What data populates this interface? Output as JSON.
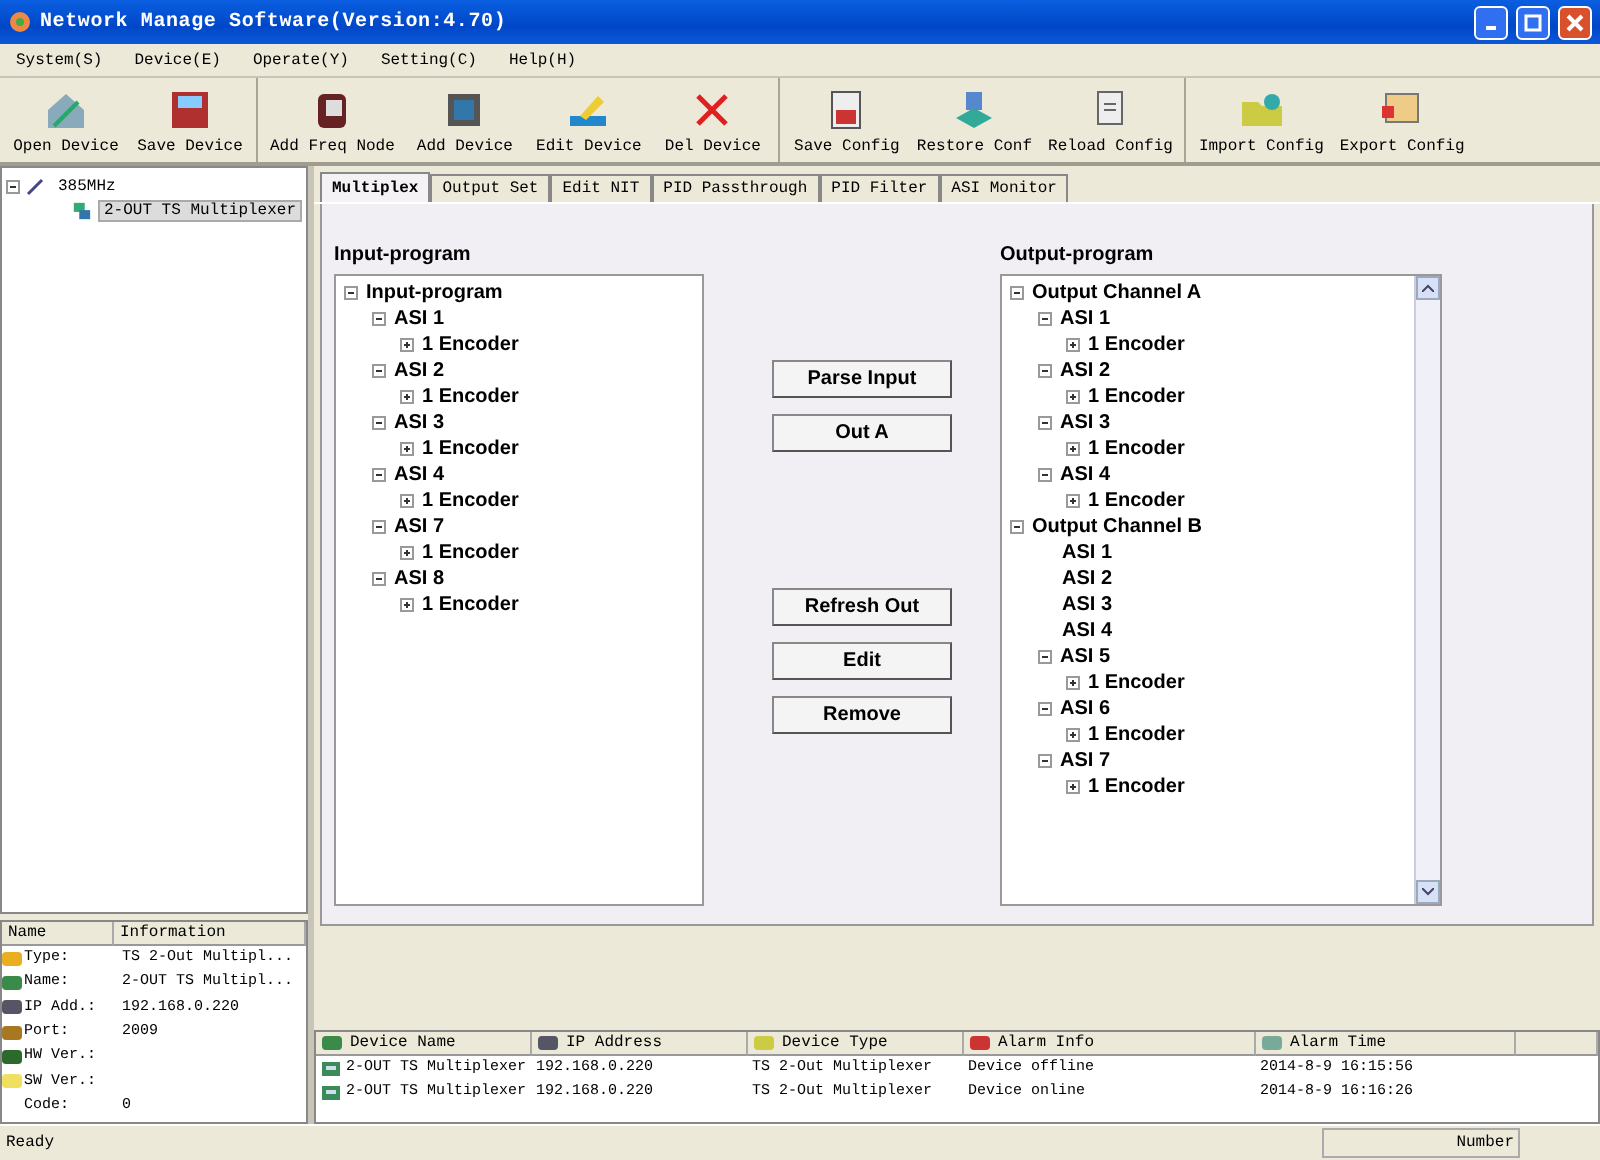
{
  "window": {
    "title": "Network Manage Software(Version:4.70)"
  },
  "menu": [
    "System(S)",
    "Device(E)",
    "Operate(Y)",
    "Setting(C)",
    "Help(H)"
  ],
  "toolbar": [
    [
      "Open Device",
      "Save Device"
    ],
    [
      "Add Freq Node",
      "Add Device",
      "Edit Device",
      "Del Device"
    ],
    [
      "Save Config",
      "Restore Conf",
      "Reload Config"
    ],
    [
      "Import Config",
      "Export Config"
    ]
  ],
  "device_tree": [
    {
      "label": "385MHz",
      "expanded": true,
      "selected": false,
      "children": [
        {
          "label": "2-OUT TS Multiplexer",
          "selected": true
        }
      ]
    }
  ],
  "info_panel": {
    "columns": [
      "Name",
      "Information"
    ],
    "rows": [
      {
        "name": "Type:",
        "value": "TS 2-Out Multipl..."
      },
      {
        "name": "Name:",
        "value": "2-OUT TS Multipl..."
      },
      {
        "name": "IP Add.:",
        "value": "192.168.0.220"
      },
      {
        "name": "Port:",
        "value": "2009"
      },
      {
        "name": "HW Ver.:",
        "value": ""
      },
      {
        "name": "SW Ver.:",
        "value": ""
      },
      {
        "name": "Code:",
        "value": "0"
      }
    ]
  },
  "tabs": [
    {
      "label": "Multiplex",
      "selected": true
    },
    {
      "label": "Output Set",
      "selected": false
    },
    {
      "label": "Edit NIT",
      "selected": false
    },
    {
      "label": "PID Passthrough",
      "selected": false
    },
    {
      "label": "PID Filter",
      "selected": false
    },
    {
      "label": "ASI Monitor",
      "selected": false
    }
  ],
  "input_program": {
    "label": "Input-program",
    "tree": [
      {
        "label": "Input-program",
        "expanded": true,
        "children": [
          {
            "label": "ASI 1",
            "expanded": true,
            "children": [
              {
                "label": "1 Encoder",
                "expanded": false
              }
            ]
          },
          {
            "label": "ASI 2",
            "expanded": true,
            "children": [
              {
                "label": "1 Encoder",
                "expanded": false
              }
            ]
          },
          {
            "label": "ASI 3",
            "expanded": true,
            "children": [
              {
                "label": "1 Encoder",
                "expanded": false
              }
            ]
          },
          {
            "label": "ASI 4",
            "expanded": true,
            "children": [
              {
                "label": "1 Encoder",
                "expanded": false
              }
            ]
          },
          {
            "label": "ASI 7",
            "expanded": true,
            "children": [
              {
                "label": "1 Encoder",
                "expanded": false
              }
            ]
          },
          {
            "label": "ASI 8",
            "expanded": true,
            "children": [
              {
                "label": "1 Encoder",
                "expanded": false
              }
            ]
          }
        ]
      }
    ]
  },
  "button_groups": [
    [
      "Parse Input",
      "Out A"
    ],
    [
      "Refresh Out",
      "Edit",
      "Remove"
    ]
  ],
  "output_program": {
    "label": "Output-program",
    "tree": [
      {
        "label": "Output Channel A",
        "expanded": true,
        "children": [
          {
            "label": "ASI 1",
            "expanded": true,
            "children": [
              {
                "label": "1 Encoder",
                "expanded": false
              }
            ]
          },
          {
            "label": "ASI 2",
            "expanded": true,
            "children": [
              {
                "label": "1 Encoder",
                "expanded": false
              }
            ]
          },
          {
            "label": "ASI 3",
            "expanded": true,
            "children": [
              {
                "label": "1 Encoder",
                "expanded": false
              }
            ]
          },
          {
            "label": "ASI 4",
            "expanded": true,
            "children": [
              {
                "label": "1 Encoder",
                "expanded": false
              }
            ]
          }
        ]
      },
      {
        "label": "Output Channel B",
        "expanded": true,
        "children": [
          {
            "label": "ASI 1"
          },
          {
            "label": "ASI 2"
          },
          {
            "label": "ASI 3"
          },
          {
            "label": "ASI 4"
          },
          {
            "label": "ASI 5",
            "expanded": true,
            "children": [
              {
                "label": "1 Encoder",
                "expanded": false
              }
            ]
          },
          {
            "label": "ASI 6",
            "expanded": true,
            "children": [
              {
                "label": "1 Encoder",
                "expanded": false
              }
            ]
          },
          {
            "label": "ASI 7",
            "expanded": true,
            "children": [
              {
                "label": "1 Encoder",
                "expanded": false
              }
            ]
          }
        ]
      }
    ]
  },
  "alarm_list": {
    "columns": [
      "Device Name",
      "IP Address",
      "Device Type",
      "Alarm Info",
      "Alarm Time"
    ],
    "rows": [
      [
        "2-OUT TS Multiplexer",
        "192.168.0.220",
        "TS 2-Out Multiplexer",
        "Device offline",
        "2014-8-9 16:15:56"
      ],
      [
        "2-OUT TS Multiplexer",
        "192.168.0.220",
        "TS 2-Out Multiplexer",
        "Device online",
        "2014-8-9 16:16:26"
      ]
    ]
  },
  "status_bar": [
    "Ready",
    "Number"
  ]
}
